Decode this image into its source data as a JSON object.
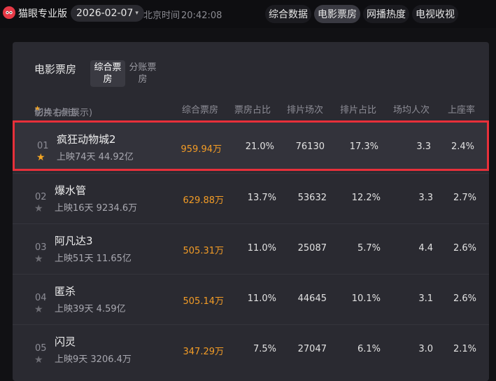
{
  "app": {
    "name": "猫眼专业版"
  },
  "date": "2026-02-07",
  "clock": {
    "label": "北京时间",
    "time": "20:42:08"
  },
  "nav": [
    "综合数据",
    "电影票房",
    "网播热度",
    "电视收视"
  ],
  "nav_active": "电影票房",
  "panel": {
    "title": "电影票房",
    "subtabs": [
      "综合票房",
      "分账票房"
    ],
    "subtab_active": "综合票房"
  },
  "headers": {
    "film_prefix": "影片 (点击",
    "film_suffix": "切换右侧展示)",
    "box_office": "综合票房",
    "box_share": "票房占比",
    "sessions": "排片场次",
    "session_share": "排片占比",
    "avg_attendance": "场均人次",
    "occupancy": "上座率"
  },
  "colors": {
    "accent_box": "#f39c26",
    "highlight_border": "#e7303a",
    "star_active": "#f5a623"
  },
  "rows": [
    {
      "rank": "01",
      "name": "疯狂动物城2",
      "sub": "上映74天  44.92亿",
      "box": "959.94万",
      "share": "21.0%",
      "sessions": "76130",
      "session_share": "17.3%",
      "avg": "3.3",
      "occ": "2.4%"
    },
    {
      "rank": "02",
      "name": "爆水管",
      "sub": "上映16天  9234.6万",
      "box": "629.88万",
      "share": "13.7%",
      "sessions": "53632",
      "session_share": "12.2%",
      "avg": "3.3",
      "occ": "2.7%"
    },
    {
      "rank": "03",
      "name": "阿凡达3",
      "sub": "上映51天  11.65亿",
      "box": "505.31万",
      "share": "11.0%",
      "sessions": "25087",
      "session_share": "5.7%",
      "avg": "4.4",
      "occ": "2.6%"
    },
    {
      "rank": "04",
      "name": "匿杀",
      "sub": "上映39天  4.59亿",
      "box": "505.14万",
      "share": "11.0%",
      "sessions": "44645",
      "session_share": "10.1%",
      "avg": "3.1",
      "occ": "2.6%"
    },
    {
      "rank": "05",
      "name": "闪灵",
      "sub": "上映9天  3206.4万",
      "box": "347.29万",
      "share": "7.5%",
      "sessions": "27047",
      "session_share": "6.1%",
      "avg": "3.0",
      "occ": "2.1%"
    }
  ]
}
